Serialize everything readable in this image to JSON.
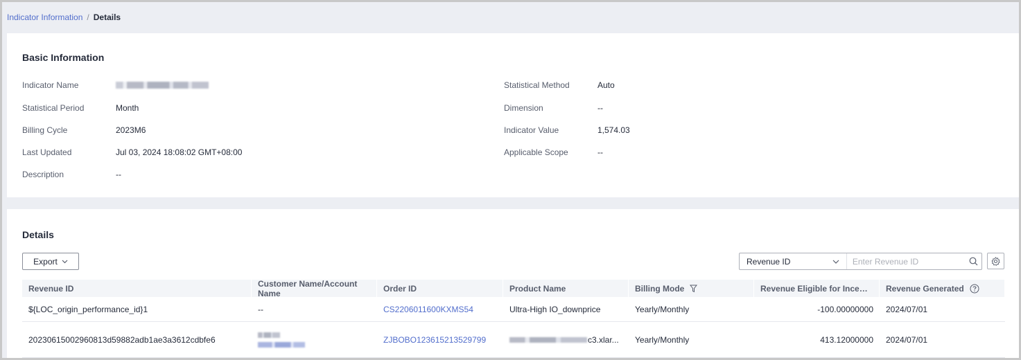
{
  "breadcrumb": {
    "parent": "Indicator Information",
    "separator": "/",
    "current": "Details"
  },
  "basic": {
    "title": "Basic Information",
    "fields": [
      {
        "label": "Indicator Name",
        "value": ""
      },
      {
        "label": "Statistical Period",
        "value": "Month"
      },
      {
        "label": "Billing Cycle",
        "value": "2023M6"
      },
      {
        "label": "Last Updated",
        "value": "Jul 03, 2024 18:08:02 GMT+08:00"
      },
      {
        "label": "Description",
        "value": "--"
      },
      {
        "label": "Statistical Method",
        "value": "Auto"
      },
      {
        "label": "Dimension",
        "value": "--"
      },
      {
        "label": "Indicator Value",
        "value": "1,574.03"
      },
      {
        "label": "Applicable Scope",
        "value": "--"
      }
    ]
  },
  "details": {
    "title": "Details",
    "export_label": "Export",
    "search": {
      "field": "Revenue ID",
      "placeholder": "Enter Revenue ID"
    },
    "columns": [
      "Revenue ID",
      "Customer Name/Account Name",
      "Order ID",
      "Product Name",
      "Billing Mode",
      "Revenue Eligible for Incentiv...",
      "Revenue Generated"
    ],
    "rows": [
      {
        "revenue_id": "${LOC_origin_performance_id}1",
        "customer": "--",
        "order_id": "CS2206011600KXMS54",
        "product": "Ultra-High IO_downprice",
        "billing_mode": "Yearly/Monthly",
        "eligible": "-100.00000000",
        "generated": "2024/07/01"
      },
      {
        "revenue_id": "20230615002960813d59882adb1ae3a3612cdbfe6",
        "customer": "",
        "order_id": "ZJBOBO123615213529799",
        "product": "c3.xlar...",
        "billing_mode": "Yearly/Monthly",
        "eligible": "413.12000000",
        "generated": "2024/07/01"
      }
    ]
  },
  "colors": {
    "link": "#526ecc",
    "text": "#252b3a",
    "label": "#575d6c",
    "header_bg": "#f3f5f8",
    "page_bg": "#eceef3"
  }
}
